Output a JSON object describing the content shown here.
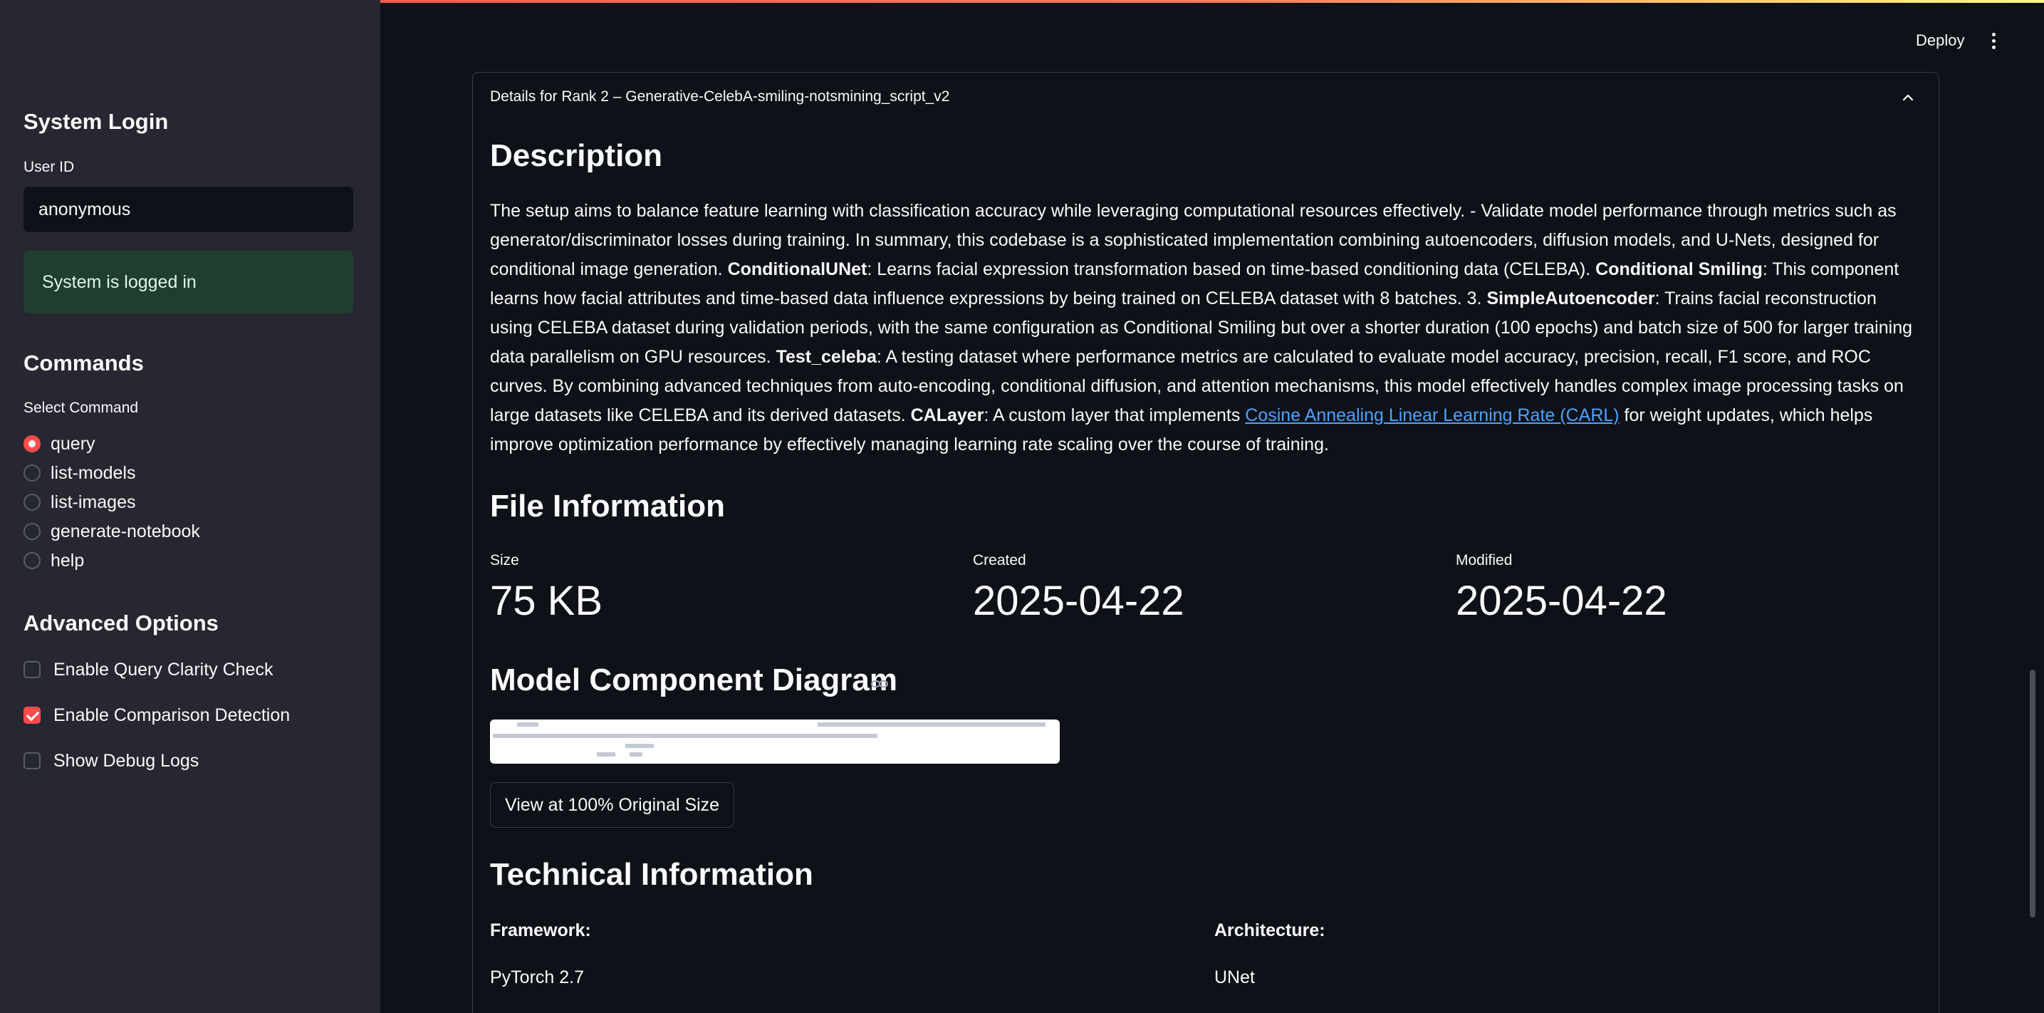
{
  "header": {
    "deploy_label": "Deploy"
  },
  "sidebar": {
    "login_heading": "System Login",
    "user_id_label": "User ID",
    "user_id_value": "anonymous",
    "status_message": "System is logged in",
    "commands_heading": "Commands",
    "select_command_label": "Select Command",
    "commands": [
      {
        "label": "query",
        "selected": true
      },
      {
        "label": "list-models",
        "selected": false
      },
      {
        "label": "list-images",
        "selected": false
      },
      {
        "label": "generate-notebook",
        "selected": false
      },
      {
        "label": "help",
        "selected": false
      }
    ],
    "advanced_heading": "Advanced Options",
    "options": [
      {
        "label": "Enable Query Clarity Check",
        "checked": false
      },
      {
        "label": "Enable Comparison Detection",
        "checked": true
      },
      {
        "label": "Show Debug Logs",
        "checked": false
      }
    ]
  },
  "expander": {
    "title": "Details for Rank 2 – Generative-CelebA-smiling-notsmining_script_v2"
  },
  "description": {
    "heading": "Description",
    "p1": "The setup aims to balance feature learning with classification accuracy while leveraging computational resources effectively. - Validate model performance through metrics such as generator/discriminator losses during training. In summary, this codebase is a sophisticated implementation combining autoencoders, diffusion models, and U-Nets, designed for conditional image generation. ",
    "b1": "ConditionalUNet",
    "p2": ": Learns facial expression transformation based on time-based conditioning data (CELEBA). ",
    "b2": "Conditional Smiling",
    "p3": ": This component learns how facial attributes and time-based data influence expressions by being trained on CELEBA dataset with 8 batches. 3. ",
    "b3": "SimpleAutoencoder",
    "p4": ": Trains facial reconstruction using CELEBA dataset during validation periods, with the same configuration as Conditional Smiling but over a shorter duration (100 epochs) and batch size of 500 for larger training data parallelism on GPU resources. ",
    "b4": "Test_celeba",
    "p5": ": A testing dataset where performance metrics are calculated to evaluate model accuracy, precision, recall, F1 score, and ROC curves. By combining advanced techniques from auto-encoding, conditional diffusion, and attention mechanisms, this model effectively handles complex image processing tasks on large datasets like CELEBA and its derived datasets. ",
    "b5": "CALayer",
    "p6": ": A custom layer that implements ",
    "link": "Cosine Annealing Linear Learning Rate (CARL)",
    "p7": " for weight updates, which helps improve optimization performance by effectively managing learning rate scaling over the course of training."
  },
  "file_info": {
    "heading": "File Information",
    "size_label": "Size",
    "size_value": "75 KB",
    "created_label": "Created",
    "created_value": "2025-04-22",
    "modified_label": "Modified",
    "modified_value": "2025-04-22"
  },
  "diagram": {
    "heading": "Model Component Diagram",
    "button_label": "View at 100% Original Size"
  },
  "tech_info": {
    "heading": "Technical Information",
    "framework_label": "Framework:",
    "framework_value": "PyTorch 2.7",
    "architecture_label": "Architecture:",
    "architecture_value": "UNet"
  },
  "colors": {
    "accent": "#ff4b4b",
    "sidebar_bg": "#262730",
    "main_bg": "#0e1117",
    "success_bg": "#1f3e2e",
    "link": "#4ba3ff"
  }
}
